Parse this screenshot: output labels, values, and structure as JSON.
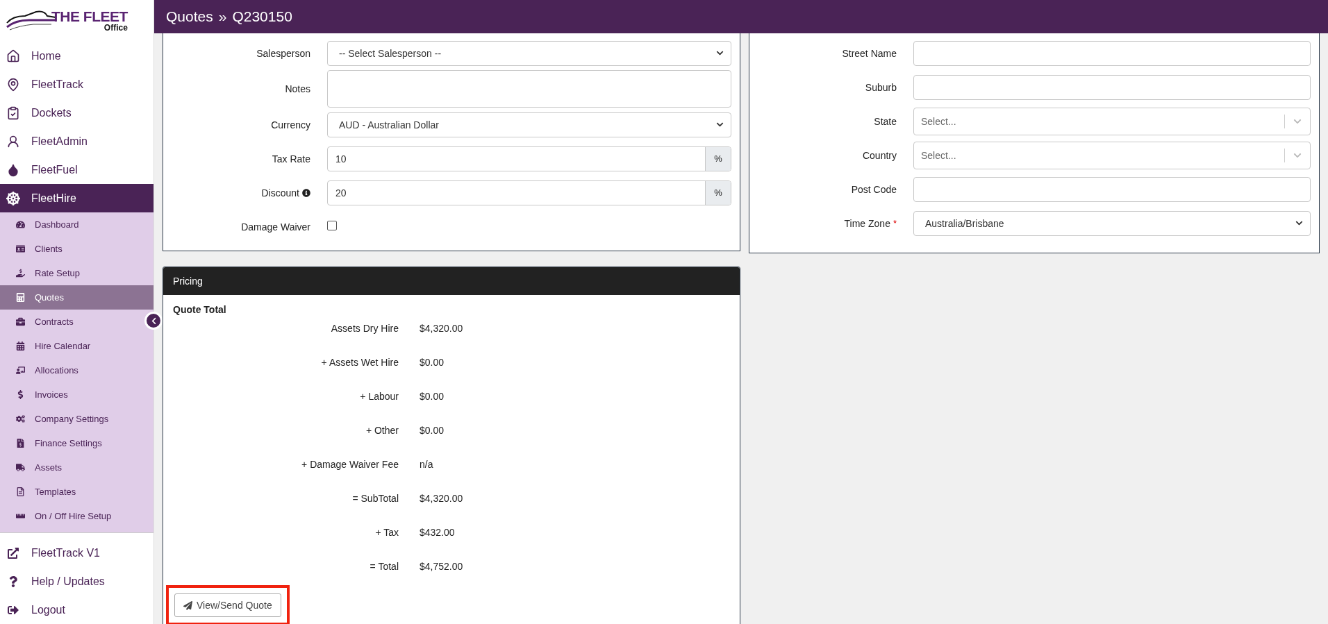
{
  "logo": {
    "title": "THE FLEET",
    "subtitle": "Office"
  },
  "header": {
    "section": "Quotes",
    "separator": "»",
    "record": "Q230150"
  },
  "sidebar": {
    "items": [
      {
        "label": "Home",
        "selected": false
      },
      {
        "label": "FleetTrack",
        "selected": false
      },
      {
        "label": "Dockets",
        "selected": false
      },
      {
        "label": "FleetAdmin",
        "selected": false
      },
      {
        "label": "FleetFuel",
        "selected": false
      },
      {
        "label": "FleetHire",
        "selected": true,
        "expanded": true,
        "children": [
          {
            "label": "Dashboard",
            "selected": false
          },
          {
            "label": "Clients",
            "selected": false
          },
          {
            "label": "Rate Setup",
            "selected": false
          },
          {
            "label": "Quotes",
            "selected": true
          },
          {
            "label": "Contracts",
            "selected": false
          },
          {
            "label": "Hire Calendar",
            "selected": false
          },
          {
            "label": "Allocations",
            "selected": false
          },
          {
            "label": "Invoices",
            "selected": false
          },
          {
            "label": "Company Settings",
            "selected": false
          },
          {
            "label": "Finance Settings",
            "selected": false
          },
          {
            "label": "Assets",
            "selected": false
          },
          {
            "label": "Templates",
            "selected": false
          },
          {
            "label": "On / Off Hire Setup",
            "selected": false
          }
        ]
      }
    ],
    "footer_items": [
      {
        "label": "FleetTrack V1"
      },
      {
        "label": "Help / Updates"
      },
      {
        "label": "Logout"
      }
    ]
  },
  "quote_form": {
    "fields": [
      {
        "kind": "select",
        "label": "Salesperson",
        "value": "-- Select Salesperson --"
      },
      {
        "kind": "textarea",
        "label": "Notes"
      },
      {
        "kind": "select",
        "label": "Currency",
        "value": "AUD - Australian Dollar"
      },
      {
        "kind": "addon",
        "label": "Tax Rate",
        "value": "10",
        "addon": "%"
      },
      {
        "kind": "addon",
        "label": "Discount",
        "value": "20",
        "addon": "%",
        "info": true
      },
      {
        "kind": "checkbox",
        "label": "Damage Waiver",
        "checked": false
      }
    ]
  },
  "address_form": {
    "fields": [
      {
        "kind": "text",
        "label": "Street Name",
        "required": false
      },
      {
        "kind": "text",
        "label": "Suburb",
        "required": false
      },
      {
        "kind": "combo",
        "label": "State",
        "placeholder": "Select...",
        "required": false
      },
      {
        "kind": "combo",
        "label": "Country",
        "placeholder": "Select...",
        "required": false
      },
      {
        "kind": "text",
        "label": "Post Code",
        "required": false
      },
      {
        "kind": "select",
        "label": "Time Zone",
        "value": "Australia/Brisbane",
        "required": true,
        "required_mark": "*"
      }
    ]
  },
  "pricing": {
    "title": "Pricing",
    "subtitle": "Quote Total",
    "rows": [
      {
        "label": "Assets Dry Hire",
        "value": "$4,320.00"
      },
      {
        "label": "+ Assets Wet Hire",
        "value": "$0.00"
      },
      {
        "label": "+ Labour",
        "value": "$0.00"
      },
      {
        "label": "+ Other",
        "value": "$0.00"
      },
      {
        "label": "+ Damage Waiver Fee",
        "value": "n/a"
      },
      {
        "label": "= SubTotal",
        "value": "$4,320.00"
      },
      {
        "label": "+ Tax",
        "value": "$432.00"
      },
      {
        "label": "= Total",
        "value": "$4,752.00"
      }
    ],
    "button": {
      "label": "View/Send Quote",
      "highlighted": true
    }
  }
}
